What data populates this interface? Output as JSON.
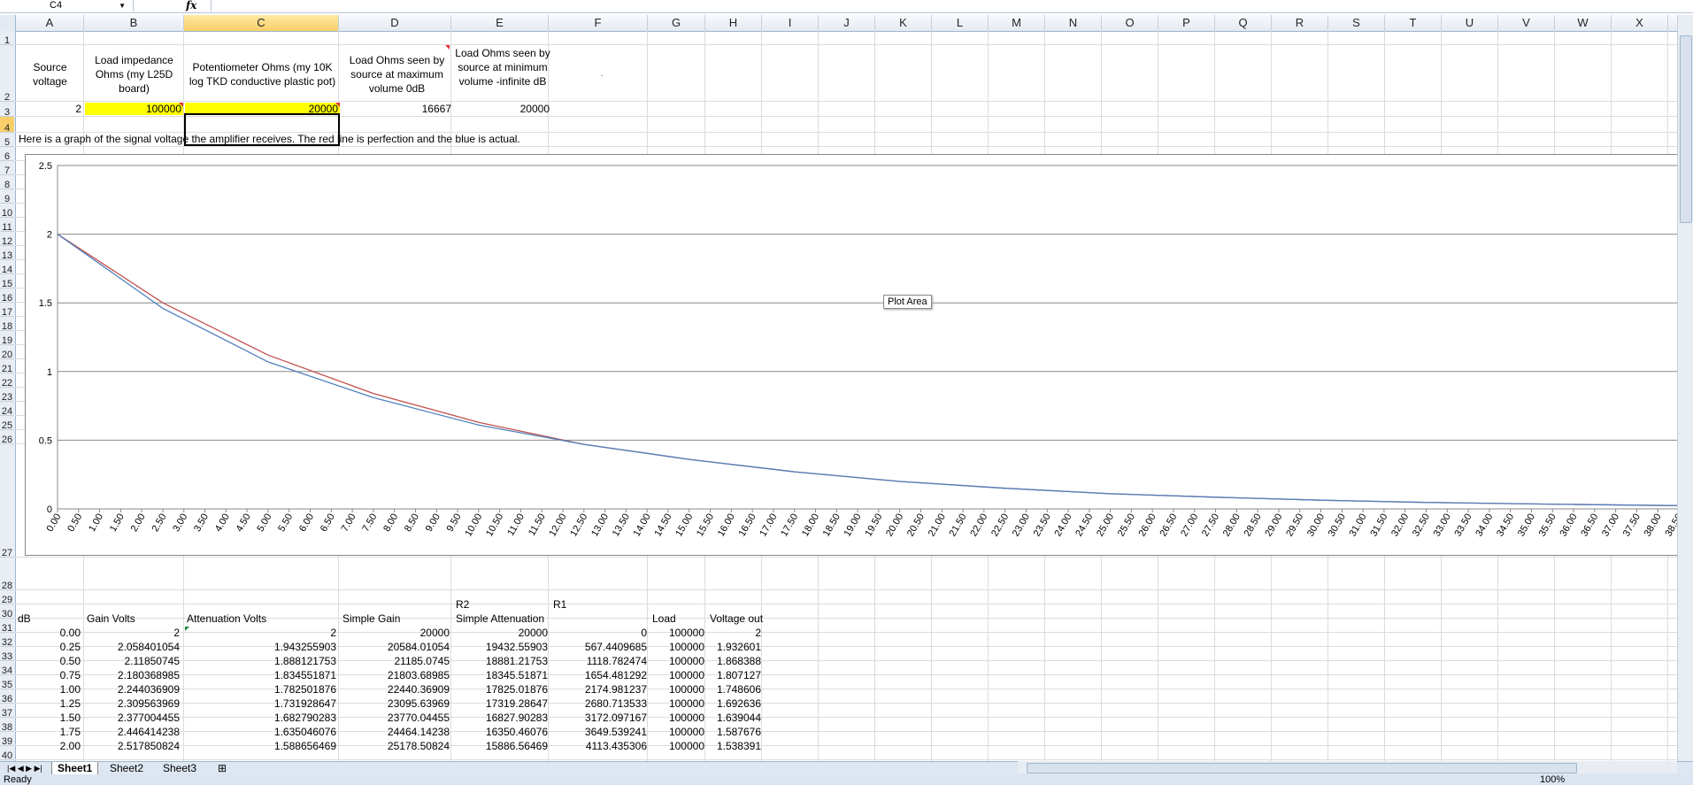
{
  "formula_bar": {
    "name_box": "C4",
    "fx": "fx"
  },
  "columns": [
    "A",
    "B",
    "C",
    "D",
    "E",
    "F",
    "G",
    "H",
    "I",
    "J",
    "K",
    "L",
    "M",
    "N",
    "O",
    "P",
    "Q",
    "R",
    "S",
    "T",
    "U",
    "V",
    "W",
    "X"
  ],
  "selected_column": "C",
  "rows": [
    "1",
    "2",
    "3",
    "4",
    "5",
    "6",
    "7",
    "8",
    "9",
    "10",
    "11",
    "12",
    "13",
    "14",
    "15",
    "16",
    "17",
    "18",
    "19",
    "20",
    "21",
    "22",
    "23",
    "24",
    "25",
    "26",
    "27",
    "28",
    "29",
    "30",
    "31",
    "32",
    "33",
    "34",
    "35",
    "36",
    "37",
    "38",
    "39",
    "40"
  ],
  "header_cells": {
    "a2": "Source voltage",
    "b2": "Load impedance Ohms (my L25D board)",
    "c2": "Potentiometer Ohms (my 10K log TKD conductive plastic pot)",
    "d2": "Load Ohms seen by source at maximum volume 0dB",
    "e2": "Load Ohms seen by source at minimum volume -infinite dB",
    "f2": "."
  },
  "row3": {
    "a": "2",
    "b": "100000",
    "c": "20000",
    "d": "16667",
    "e": "20000"
  },
  "row4_text": "Here is a graph of the signal voltage the amplifier receives.  The red line is perfection and the blue is actual.",
  "plot_area_label": "Plot Area",
  "chart_data": {
    "type": "line",
    "x": [
      0,
      2.5,
      5,
      7.5,
      10,
      12.5,
      15,
      17.5,
      20,
      22.5,
      25,
      27.5,
      30,
      32.5,
      35,
      37.5,
      38.5
    ],
    "series": [
      {
        "color": "#c0504d",
        "values": [
          2,
          1.5,
          1.12,
          0.84,
          0.63,
          0.47,
          0.36,
          0.27,
          0.2,
          0.15,
          0.11,
          0.085,
          0.063,
          0.047,
          0.036,
          0.027,
          0.024
        ]
      },
      {
        "color": "#4f81bd",
        "values": [
          2,
          1.46,
          1.07,
          0.81,
          0.61,
          0.47,
          0.36,
          0.27,
          0.2,
          0.15,
          0.11,
          0.085,
          0.063,
          0.047,
          0.036,
          0.027,
          0.024
        ]
      }
    ],
    "ylim": [
      0,
      2.5
    ],
    "yticks": [
      "0",
      "0.5",
      "1",
      "1.5",
      "2",
      "2.5"
    ],
    "xlim": [
      0,
      38.5
    ],
    "xstep": 0.5,
    "grid": true
  },
  "table": {
    "r29": {
      "e": "R2",
      "f": "R1"
    },
    "headers": [
      "dB",
      "Gain Volts",
      "Attenuation Volts",
      "Simple Gain",
      "Simple Attenuation",
      "",
      "Load",
      "Voltage out"
    ],
    "rows": [
      [
        "0.00",
        "2",
        "2",
        "20000",
        "20000",
        "0",
        "100000",
        "2"
      ],
      [
        "0.25",
        "2.058401054",
        "1.943255903",
        "20584.01054",
        "19432.55903",
        "567.4409685",
        "100000",
        "1.932601"
      ],
      [
        "0.50",
        "2.11850745",
        "1.888121753",
        "21185.0745",
        "18881.21753",
        "1118.782474",
        "100000",
        "1.868388"
      ],
      [
        "0.75",
        "2.180368985",
        "1.834551871",
        "21803.68985",
        "18345.51871",
        "1654.481292",
        "100000",
        "1.807127"
      ],
      [
        "1.00",
        "2.244036909",
        "1.782501876",
        "22440.36909",
        "17825.01876",
        "2174.981237",
        "100000",
        "1.748606"
      ],
      [
        "1.25",
        "2.309563969",
        "1.731928647",
        "23095.63969",
        "17319.28647",
        "2680.713533",
        "100000",
        "1.692636"
      ],
      [
        "1.50",
        "2.377004455",
        "1.682790283",
        "23770.04455",
        "16827.90283",
        "3172.097167",
        "100000",
        "1.639044"
      ],
      [
        "1.75",
        "2.446414238",
        "1.635046076",
        "24464.14238",
        "16350.46076",
        "3649.539241",
        "100000",
        "1.587676"
      ],
      [
        "2.00",
        "2.517850824",
        "1.588656469",
        "25178.50824",
        "15886.56469",
        "4113.435306",
        "100000",
        "1.538391"
      ]
    ]
  },
  "sheets": [
    "Sheet1",
    "Sheet2",
    "Sheet3"
  ],
  "status": {
    "left": "Ready",
    "zoom": "100%"
  }
}
